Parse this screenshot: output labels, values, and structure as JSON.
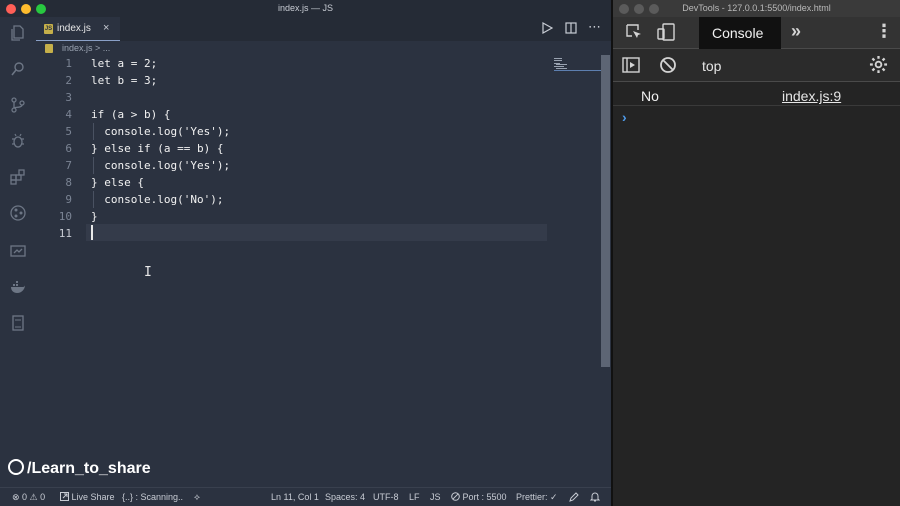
{
  "vscode": {
    "title": "index.js — JS",
    "tab": {
      "label": "index.js",
      "close": "×"
    },
    "breadcrumb": "index.js > ...",
    "line_numbers": [
      "1",
      "2",
      "3",
      "4",
      "5",
      "6",
      "7",
      "8",
      "9",
      "10",
      "11"
    ],
    "code_lines": [
      "let a = 2;",
      "let b = 3;",
      "",
      "if (a > b) {",
      "  console.log('Yes');",
      "} else if (a == b) {",
      "  console.log('Yes');",
      "} else {",
      "  console.log('No');",
      "}",
      ""
    ],
    "watermark": "/Learn_to_share",
    "statusbar": {
      "problems": "⊗ 0 ⚠ 0",
      "live_share": "Live Share",
      "scanning": "{..} : Scanning..",
      "cursor_pos": "Ln 11, Col 1",
      "spaces": "Spaces: 4",
      "encoding": "UTF-8",
      "eol": "LF",
      "language": "JS",
      "port": "Port : 5500",
      "prettier": "Prettier: ✓"
    }
  },
  "devtools": {
    "title": "DevTools - 127.0.0.1:5500/index.html",
    "console_tab": "Console",
    "more_tabs": "»",
    "context": "top",
    "log": {
      "message": "No",
      "source": "index.js:9"
    },
    "prompt": "›"
  }
}
